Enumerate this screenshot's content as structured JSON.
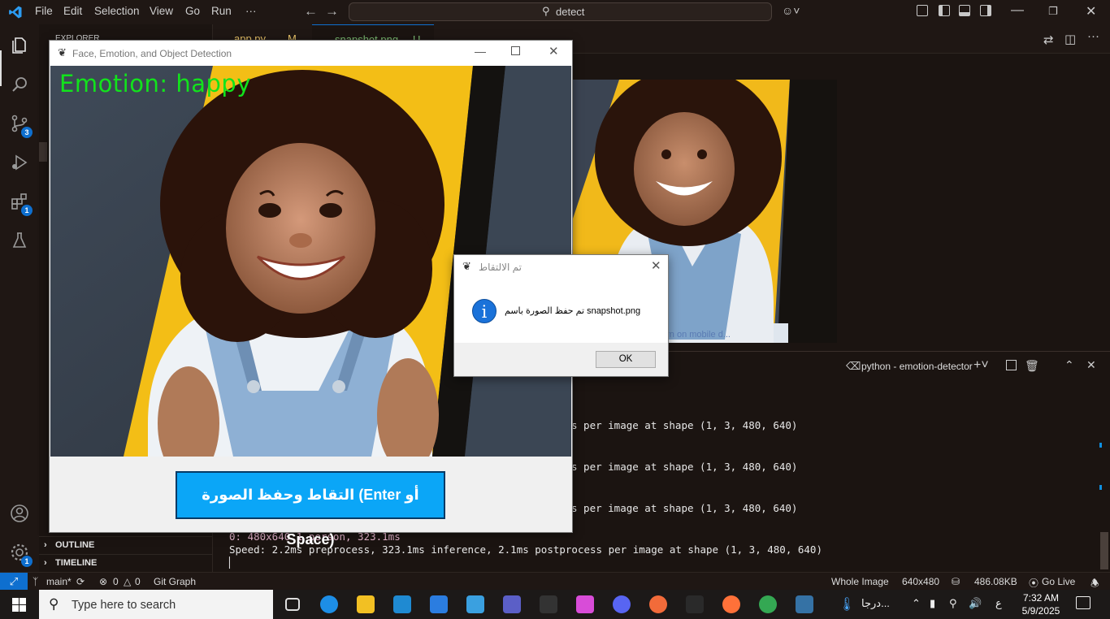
{
  "vscode": {
    "menu": [
      "File",
      "Edit",
      "Selection",
      "View",
      "Go",
      "Run",
      "···"
    ],
    "command_center": "detect",
    "sidebar_title": "EXPLORER",
    "badges": {
      "source_control": "3",
      "extensions": "1",
      "manage": "1"
    },
    "tabs": [
      {
        "label": "app.py",
        "status": "M"
      },
      {
        "label": "snapshot.png",
        "status": "U"
      }
    ],
    "outline_label": "OUTLINE",
    "timeline_label": "TIMELINE",
    "terminal": {
      "title": "python - emotion-detector",
      "lines": [
        "s per image at shape (1, 3, 480, 640)",
        "s per image at shape (1, 3, 480, 640)",
        "s per image at shape (1, 3, 480, 640)"
      ],
      "detect_line": "0: 480x640 1 person, 323.1ms",
      "speed_line": "Speed: 2.2ms preprocess, 323.1ms inference, 2.1ms postprocess per image at shape (1, 3, 480, 640)",
      "cursor": "▏"
    },
    "preview_caption": "urn on mobile d...",
    "statusbar": {
      "remote_icon": "⤢",
      "branch": "main*",
      "errors": "0",
      "warnings": "0",
      "git_graph": "Git Graph",
      "whole_image": "Whole Image",
      "dimensions": "640x480",
      "size": "486.08KB",
      "go_live": "Go Live"
    }
  },
  "app_window": {
    "title": "Face, Emotion, and Object Detection",
    "emotion_text": "Emotion: happy",
    "capture_button": "التقاط وحفظ الصورة (Enter أو Space)"
  },
  "messagebox": {
    "title": "تم الالتقاط",
    "icon_glyph": "i",
    "text": "تم حفظ الصورة باسم snapshot.png",
    "ok": "OK"
  },
  "taskbar": {
    "search_placeholder": "Type here to search",
    "weather": "درجا...",
    "language": "ع",
    "time": "7:32 AM",
    "date": "5/9/2025",
    "apps": [
      {
        "name": "task-view",
        "color": "#1c1918"
      },
      {
        "name": "edge",
        "color": "#1d8ee6"
      },
      {
        "name": "file-explorer",
        "color": "#f2c023"
      },
      {
        "name": "vscode",
        "color": "#1f8ad2"
      },
      {
        "name": "store",
        "color": "#2b7de0"
      },
      {
        "name": "remote",
        "color": "#3aa0e0"
      },
      {
        "name": "teams",
        "color": "#5b5fc7"
      },
      {
        "name": "dev",
        "color": "#333333"
      },
      {
        "name": "m365",
        "color": "#d84cd8"
      },
      {
        "name": "discord",
        "color": "#5865f2"
      },
      {
        "name": "postman",
        "color": "#f26b3a"
      },
      {
        "name": "wsl",
        "color": "#2a2a2a"
      },
      {
        "name": "firefox",
        "color": "#ff7139"
      },
      {
        "name": "chrome",
        "color": "#34a853"
      },
      {
        "name": "python",
        "color": "#3572a5"
      }
    ]
  }
}
